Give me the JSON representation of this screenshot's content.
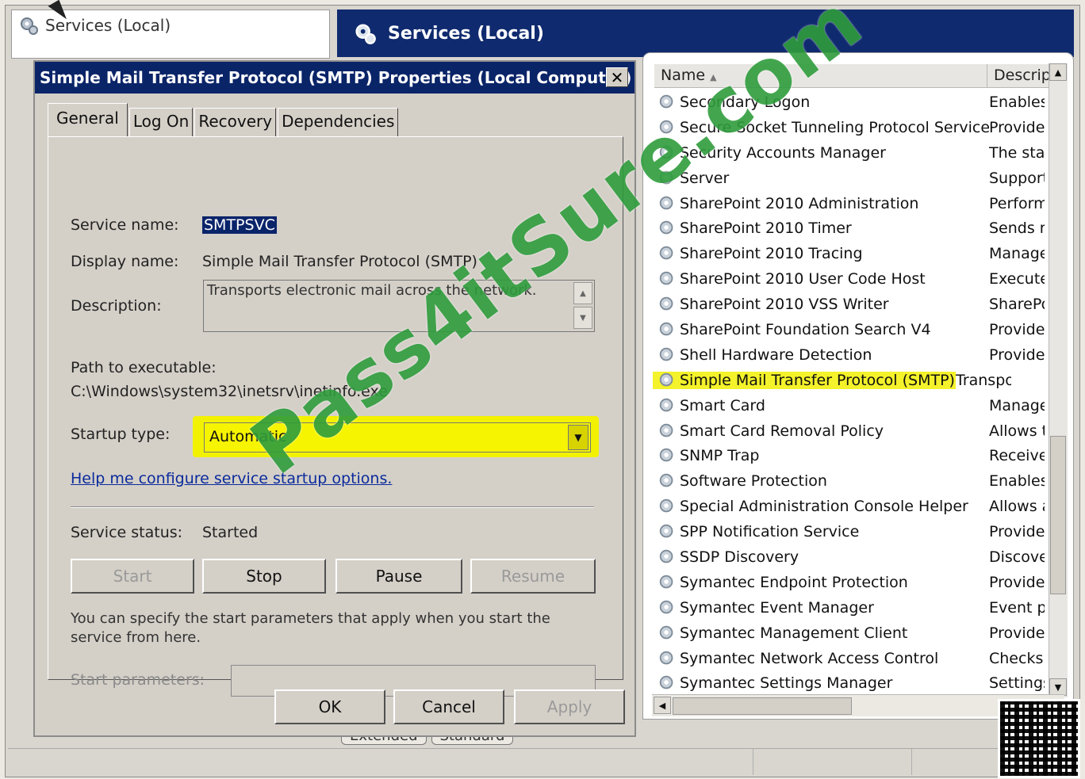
{
  "tree": {
    "node_label": "Services (Local)"
  },
  "header": {
    "title": "Services (Local)"
  },
  "list": {
    "columns": {
      "name": "Name",
      "description": "Descripti"
    },
    "rows": [
      {
        "name": "Secondary Logon",
        "desc": "Enables"
      },
      {
        "name": "Secure Socket Tunneling Protocol Service",
        "desc": "Provide"
      },
      {
        "name": "Security Accounts Manager",
        "desc": "The sta"
      },
      {
        "name": "Server",
        "desc": "Support"
      },
      {
        "name": "SharePoint 2010 Administration",
        "desc": "Perform"
      },
      {
        "name": "SharePoint 2010 Timer",
        "desc": "Sends r"
      },
      {
        "name": "SharePoint 2010 Tracing",
        "desc": "Manage"
      },
      {
        "name": "SharePoint 2010 User Code Host",
        "desc": "Execute"
      },
      {
        "name": "SharePoint 2010 VSS Writer",
        "desc": "SharePo"
      },
      {
        "name": "SharePoint Foundation Search V4",
        "desc": "Provide"
      },
      {
        "name": "Shell Hardware Detection",
        "desc": "Provide"
      },
      {
        "name": "Simple Mail Transfer Protocol (SMTP)",
        "desc": "Transpo"
      },
      {
        "name": "Smart Card",
        "desc": "Manage"
      },
      {
        "name": "Smart Card Removal Policy",
        "desc": "Allows t"
      },
      {
        "name": "SNMP Trap",
        "desc": "Receive"
      },
      {
        "name": "Software Protection",
        "desc": "Enables"
      },
      {
        "name": "Special Administration Console Helper",
        "desc": "Allows a"
      },
      {
        "name": "SPP Notification Service",
        "desc": "Provide"
      },
      {
        "name": "SSDP Discovery",
        "desc": "Discove"
      },
      {
        "name": "Symantec Endpoint Protection",
        "desc": "Provide"
      },
      {
        "name": "Symantec Event Manager",
        "desc": "Event p"
      },
      {
        "name": "Symantec Management Client",
        "desc": "Provide"
      },
      {
        "name": "Symantec Network Access Control",
        "desc": "Checks"
      },
      {
        "name": "Symantec Settings Manager",
        "desc": "Settings"
      }
    ]
  },
  "bottom_tabs": {
    "extended": "Extended",
    "standard": "Standard"
  },
  "dialog": {
    "title": "Simple Mail Transfer Protocol (SMTP) Properties (Local Computer)",
    "close": "✕",
    "tabs": {
      "general": "General",
      "logon": "Log On",
      "recovery": "Recovery",
      "dependencies": "Dependencies"
    },
    "service_name_label": "Service name:",
    "service_name": "SMTPSVC",
    "display_name_label": "Display name:",
    "display_name": "Simple Mail Transfer Protocol (SMTP)",
    "description_label": "Description:",
    "description": "Transports electronic mail across the network.",
    "path_label": "Path to executable:",
    "path": "C:\\Windows\\system32\\inetsrv\\inetinfo.exe",
    "startup_label": "Startup type:",
    "startup_value": "Automatic",
    "help_link": "Help me configure service startup options.",
    "status_label": "Service status:",
    "status_value": "Started",
    "buttons": {
      "start": "Start",
      "stop": "Stop",
      "pause": "Pause",
      "resume": "Resume"
    },
    "help_text": "You can specify the start parameters that apply when you start the service from here.",
    "start_params_label": "Start parameters:",
    "ok": "OK",
    "cancel": "Cancel",
    "apply": "Apply"
  },
  "watermark": "Pass4itSure.com",
  "colors": {
    "title_bar": "#0a2468",
    "highlight": "#f4f22a",
    "watermark": "#2f9d3d"
  }
}
